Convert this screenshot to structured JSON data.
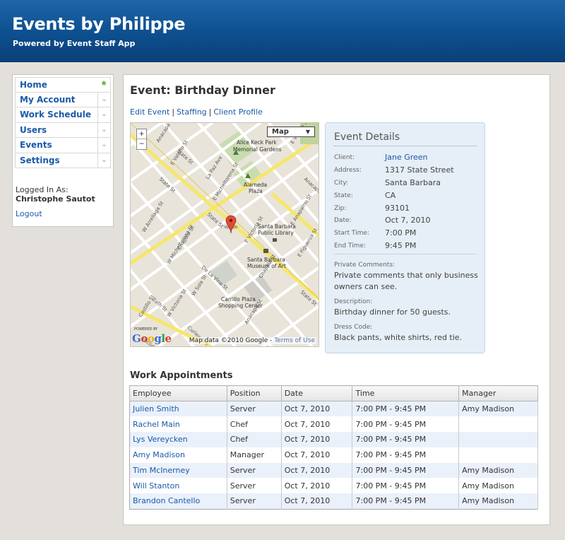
{
  "header": {
    "title": "Events by Philippe",
    "subtitle": "Powered by Event Staff App"
  },
  "sidebar": {
    "items": [
      {
        "label": "Home",
        "icon": "star-icon"
      },
      {
        "label": "My Account",
        "icon": "chevron-down-icon"
      },
      {
        "label": "Work Schedule",
        "icon": "chevron-down-icon"
      },
      {
        "label": "Users",
        "icon": "chevron-down-icon"
      },
      {
        "label": "Events",
        "icon": "chevron-down-icon"
      },
      {
        "label": "Settings",
        "icon": "chevron-down-icon"
      }
    ],
    "logged_in_label": "Logged In As:",
    "user_name": "Christophe Sautot",
    "logout": "Logout"
  },
  "main": {
    "title": "Event: Birthday Dinner",
    "links": [
      "Edit Event",
      "Staffing",
      "Client Profile"
    ],
    "map": {
      "type_label": "Map",
      "zoom_in": "+",
      "zoom_out": "−",
      "powered_by": "POWERED BY",
      "logo": "Google",
      "attribution": "Map data ©2010 Google -",
      "terms": "Terms of Use",
      "streets": [
        "State St",
        "Chapala St",
        "De La Vina St",
        "Anacapa St",
        "E Anapamu St",
        "W Sola St",
        "E Victoria St",
        "W Victoria St",
        "La Paz Ave",
        "Bath St",
        "Castillo St",
        "Curley Ave",
        "Euclid Ave",
        "W Arrellaga St",
        "E Figueroa St",
        "W Micheltorena St",
        "E Valerio St",
        "E Arrellaga St",
        "W Valerio St"
      ],
      "places": [
        "Alice Keck Park Memorial Gardens",
        "Alameda Plaza",
        "Santa Barbara Public Library",
        "Santa Barbara Museum of Art",
        "Carrillo Plaza Shopping Center"
      ]
    },
    "details": {
      "heading": "Event Details",
      "rows": [
        {
          "key": "Client:",
          "value": "Jane Green"
        },
        {
          "key": "Address:",
          "value": "1317 State Street"
        },
        {
          "key": "City:",
          "value": "Santa Barbara"
        },
        {
          "key": "State:",
          "value": "CA"
        },
        {
          "key": "Zip:",
          "value": "93101"
        },
        {
          "key": "Date:",
          "value": "Oct 7, 2010"
        },
        {
          "key": "Start Time:",
          "value": "7:00 PM"
        },
        {
          "key": "End Time:",
          "value": "9:45 PM"
        }
      ],
      "private_label": "Private Comments:",
      "private_text": "Private comments that only business owners can see.",
      "description_label": "Description:",
      "description_text": "Birthday dinner for 50 guests.",
      "dress_label": "Dress Code:",
      "dress_text": "Black pants, white shirts, red tie."
    },
    "appointments": {
      "title": "Work Appointments",
      "columns": [
        "Employee",
        "Position",
        "Date",
        "Time",
        "Manager"
      ],
      "rows": [
        [
          "Julien Smith",
          "Server",
          "Oct 7, 2010",
          "7:00 PM - 9:45 PM",
          "Amy Madison"
        ],
        [
          "Rachel Main",
          "Chef",
          "Oct 7, 2010",
          "7:00 PM - 9:45 PM",
          ""
        ],
        [
          "Lys Vereycken",
          "Chef",
          "Oct 7, 2010",
          "7:00 PM - 9:45 PM",
          ""
        ],
        [
          "Amy Madison",
          "Manager",
          "Oct 7, 2010",
          "7:00 PM - 9:45 PM",
          ""
        ],
        [
          "Tim McInerney",
          "Server",
          "Oct 7, 2010",
          "7:00 PM - 9:45 PM",
          "Amy Madison"
        ],
        [
          "Will Stanton",
          "Server",
          "Oct 7, 2010",
          "7:00 PM - 9:45 PM",
          "Amy Madison"
        ],
        [
          "Brandon Cantello",
          "Server",
          "Oct 7, 2010",
          "7:00 PM - 9:45 PM",
          "Amy Madison"
        ]
      ]
    }
  },
  "colors": {
    "header_bg": "#0d4f8f",
    "link": "#1a5aa8",
    "details_bg": "#e6eef7",
    "row_stripe": "#eaf1fb",
    "home_star": "#4cae2e"
  }
}
